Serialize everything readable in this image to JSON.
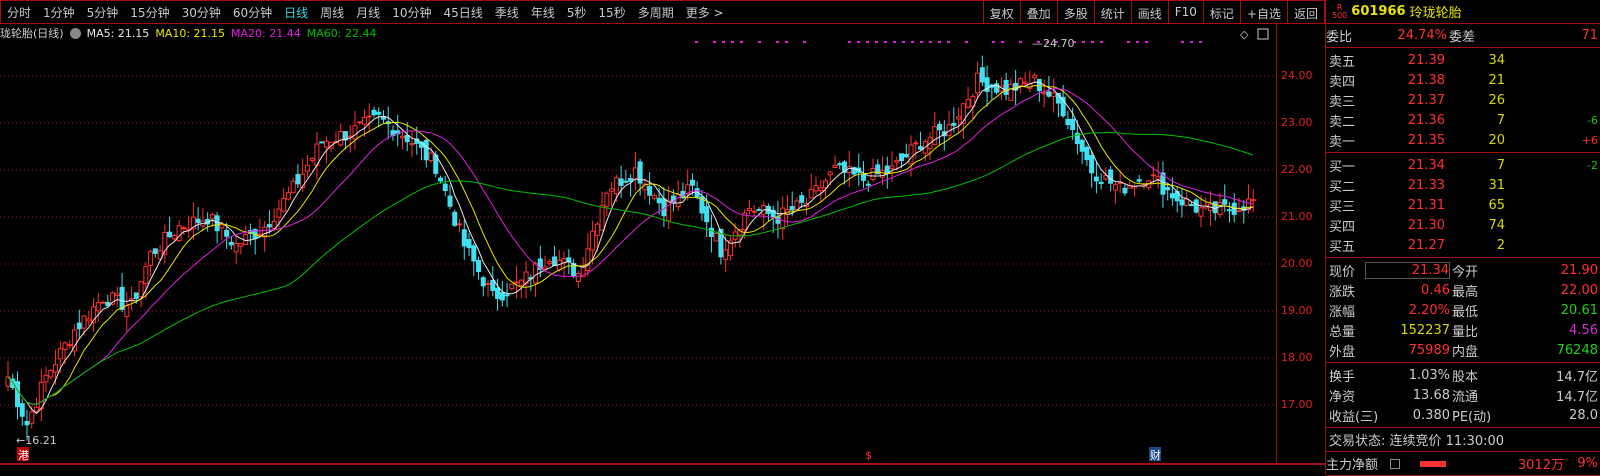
{
  "toolbar": {
    "periods": [
      "分时",
      "1分钟",
      "5分钟",
      "15分钟",
      "30分钟",
      "60分钟",
      "日线",
      "周线",
      "月线",
      "10分钟",
      "45日线",
      "季线",
      "年线",
      "5秒",
      "15秒",
      "多周期",
      "更多 >"
    ],
    "active": "日线",
    "tools": [
      "复权",
      "叠加",
      "多股",
      "统计",
      "画线",
      "F10",
      "标记",
      "+自选",
      "返回"
    ]
  },
  "legend": {
    "title": "珑轮胎(日线)",
    "ma5": "MA5: 21.15",
    "ma10": "MA10: 21.15",
    "ma20": "MA20: 21.44",
    "ma60": "MA60: 22.44"
  },
  "colors": {
    "up": "#ff3030",
    "down": "#40e0f0",
    "ma5": "#e8e8e8",
    "ma10": "#e6e600",
    "ma20": "#e020e0",
    "ma60": "#00c000",
    "grid": "#a01010"
  },
  "chart_data": {
    "type": "candlestick",
    "ylim": [
      16.2,
      24.9
    ],
    "yticks": [
      "24.00",
      "23.00",
      "22.00",
      "21.00",
      "20.00",
      "19.00",
      "18.00",
      "17.00"
    ],
    "anchors": [
      [
        0,
        17.6
      ],
      [
        4,
        16.6
      ],
      [
        8,
        17.6
      ],
      [
        14,
        18.6
      ],
      [
        20,
        19.3
      ],
      [
        26,
        19.1
      ],
      [
        30,
        20.2
      ],
      [
        36,
        20.8
      ],
      [
        42,
        21.0
      ],
      [
        48,
        20.4
      ],
      [
        54,
        20.8
      ],
      [
        60,
        21.6
      ],
      [
        66,
        22.6
      ],
      [
        72,
        22.8
      ],
      [
        78,
        23.1
      ],
      [
        84,
        22.7
      ],
      [
        90,
        22.1
      ],
      [
        96,
        20.4
      ],
      [
        102,
        19.3
      ],
      [
        108,
        19.6
      ],
      [
        114,
        20.2
      ],
      [
        120,
        19.8
      ],
      [
        126,
        21.6
      ],
      [
        132,
        22.0
      ],
      [
        138,
        21.2
      ],
      [
        144,
        21.6
      ],
      [
        150,
        20.3
      ],
      [
        156,
        21.2
      ],
      [
        162,
        21.0
      ],
      [
        168,
        21.3
      ],
      [
        174,
        22.0
      ],
      [
        180,
        21.8
      ],
      [
        186,
        22.0
      ],
      [
        192,
        22.6
      ],
      [
        198,
        22.9
      ],
      [
        204,
        23.9
      ],
      [
        210,
        23.7
      ],
      [
        216,
        23.9
      ],
      [
        222,
        23.3
      ],
      [
        228,
        22.0
      ],
      [
        234,
        21.6
      ],
      [
        240,
        21.9
      ],
      [
        246,
        21.4
      ],
      [
        252,
        21.1
      ],
      [
        258,
        21.2
      ],
      [
        262,
        21.34
      ]
    ],
    "max_label": "24.70",
    "min_label": "16.21",
    "markers": [
      "港",
      "$",
      "财"
    ]
  },
  "panel": {
    "code": "601966",
    "name": "玲珑轮胎",
    "badge_r": "R",
    "badge_n": "500",
    "wb": {
      "l1": "委比",
      "v1": "24.74%",
      "l2": "委差",
      "v2": "71"
    },
    "asks": [
      {
        "l": "卖五",
        "p": "21.39",
        "v": "34",
        "c": ""
      },
      {
        "l": "卖四",
        "p": "21.38",
        "v": "21",
        "c": ""
      },
      {
        "l": "卖三",
        "p": "21.37",
        "v": "26",
        "c": ""
      },
      {
        "l": "卖二",
        "p": "21.36",
        "v": "7",
        "c": "-6"
      },
      {
        "l": "卖一",
        "p": "21.35",
        "v": "20",
        "c": "+6"
      }
    ],
    "bids": [
      {
        "l": "买一",
        "p": "21.34",
        "v": "7",
        "c": "-2"
      },
      {
        "l": "买二",
        "p": "21.33",
        "v": "31",
        "c": ""
      },
      {
        "l": "买三",
        "p": "21.31",
        "v": "65",
        "c": ""
      },
      {
        "l": "买四",
        "p": "21.30",
        "v": "74",
        "c": ""
      },
      {
        "l": "买五",
        "p": "21.27",
        "v": "2",
        "c": ""
      }
    ],
    "quote": [
      {
        "l1": "现价",
        "v1": "21.34",
        "c1": "#ff3030",
        "l2": "今开",
        "v2": "21.90",
        "c2": "#ff3030"
      },
      {
        "l1": "涨跌",
        "v1": "0.46",
        "c1": "#ff3030",
        "l2": "最高",
        "v2": "22.00",
        "c2": "#ff3030"
      },
      {
        "l1": "涨幅",
        "v1": "2.20%",
        "c1": "#ff3030",
        "l2": "最低",
        "v2": "20.61",
        "c2": "#20d020"
      },
      {
        "l1": "总量",
        "v1": "152237",
        "c1": "#d8d800",
        "l2": "量比",
        "v2": "4.56",
        "c2": "#d030d0"
      },
      {
        "l1": "外盘",
        "v1": "75989",
        "c1": "#ff3030",
        "l2": "内盘",
        "v2": "76248",
        "c2": "#20d020"
      }
    ],
    "fund": [
      {
        "l1": "换手",
        "v1": "1.03%",
        "l2": "股本",
        "v2": "14.7亿"
      },
      {
        "l1": "净资",
        "v1": "13.68",
        "l2": "流通",
        "v2": "14.7亿"
      },
      {
        "l1": "收益(三)",
        "v1": "0.380",
        "l2": "PE(动)",
        "v2": "28.0"
      }
    ],
    "status": "交易状态: 连续竞价 11:30:00",
    "flow": {
      "l": "主力净额",
      "v": "3012万",
      "p": "9%"
    }
  }
}
